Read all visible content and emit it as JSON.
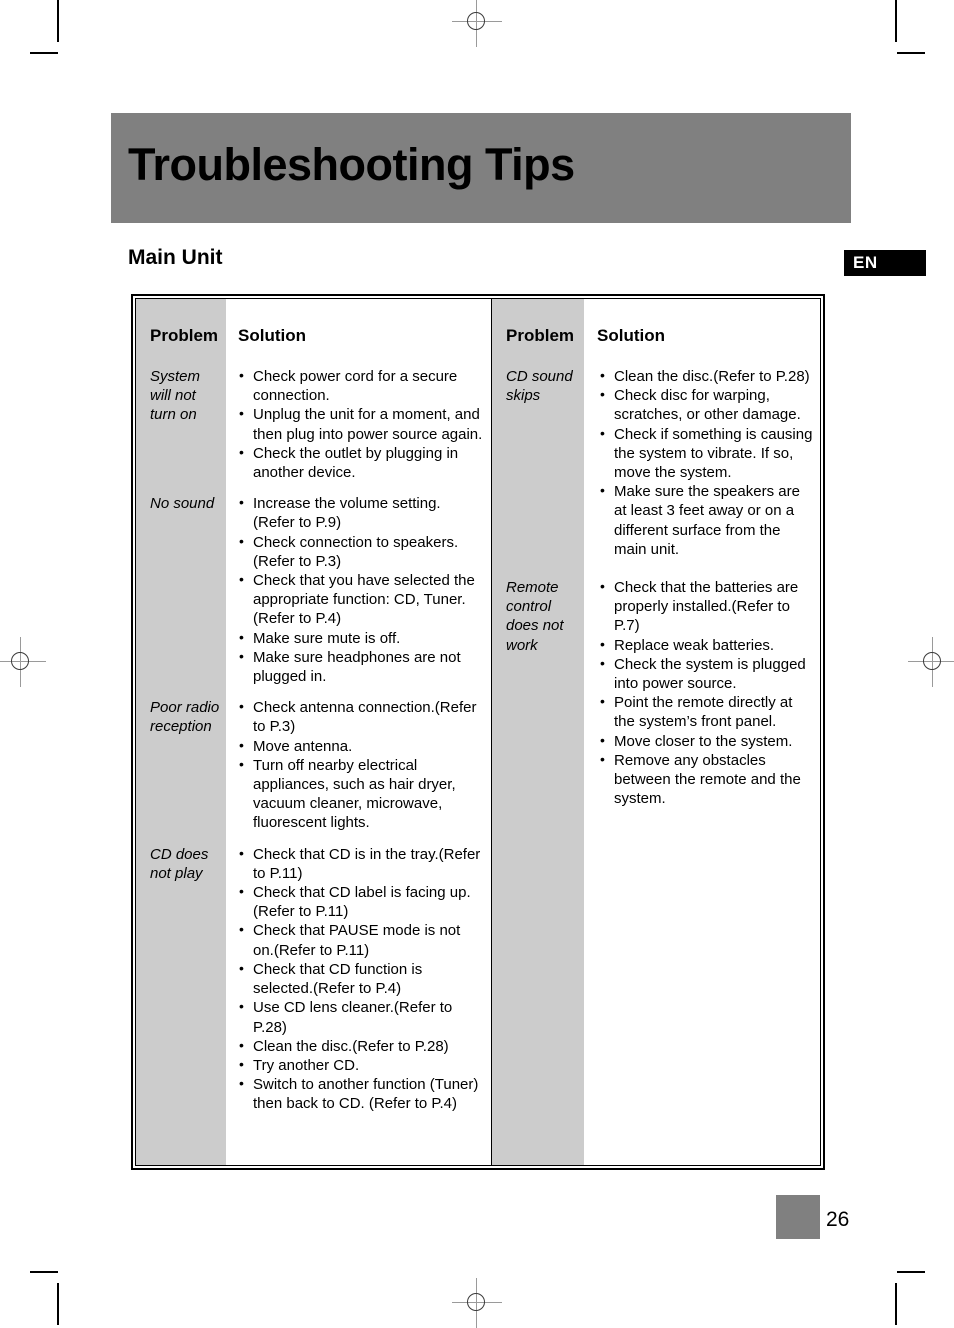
{
  "document": {
    "title": "Troubleshooting Tips",
    "section_heading": "Main Unit",
    "language_badge": "EN",
    "page_number": "26"
  },
  "table": {
    "headers": {
      "problem": "Problem",
      "solution": "Solution"
    },
    "left_column": [
      {
        "problem": "System will not turn on",
        "solutions": [
          "Check power cord for a secure connection.",
          "Unplug the unit for a moment, and then plug into power source again.",
          "Check the outlet by plugging in another device."
        ]
      },
      {
        "problem": "No sound",
        "solutions": [
          "Increase the volume setting. (Refer to P.9)",
          "Check connection to speakers. (Refer to P.3)",
          "Check that you have selected the appropriate function: CD, Tuner.(Refer to P.4)",
          "Make sure mute is off.",
          "Make sure headphones are not plugged in."
        ]
      },
      {
        "problem": "Poor radio reception",
        "solutions": [
          "Check antenna connection.(Refer to P.3)",
          "Move antenna.",
          "Turn off nearby electrical appliances, such as hair dryer, vacuum cleaner, microwave, fluorescent lights."
        ]
      },
      {
        "problem": "CD does not play",
        "solutions": [
          "Check that CD is in the tray.(Refer to P.11)",
          "Check that CD label is facing up.(Refer to P.11)",
          "Check that PAUSE mode is not on.(Refer to P.11)",
          "Check that CD function is selected.(Refer to P.4)",
          "Use CD lens cleaner.(Refer to P.28)",
          "Clean the disc.(Refer to P.28)",
          "Try another CD.",
          "Switch to another function (Tuner) then back to CD. (Refer to P.4)"
        ]
      }
    ],
    "right_column": [
      {
        "problem": "CD sound skips",
        "solutions": [
          "Clean the disc.(Refer to P.28)",
          "Check disc for warping, scratches, or other damage.",
          "Check if something is causing the system to  vibrate. If so, move the  system.",
          "Make sure the speakers are at least 3 feet away or on a different surface from the main unit."
        ]
      },
      {
        "problem": "Remote control does not work",
        "solutions": [
          "Check that the batteries are properly installed.(Refer to P.7)",
          "Replace weak batteries.",
          "Check the system is plugged into power source.",
          "Point the remote directly at the system’s front panel.",
          "Move closer to the system.",
          "Remove any obstacles between the remote and the system."
        ]
      }
    ]
  },
  "colors": {
    "banner_gray": "#808080",
    "problem_column_gray": "#cccccc",
    "badge_black": "#000000"
  }
}
